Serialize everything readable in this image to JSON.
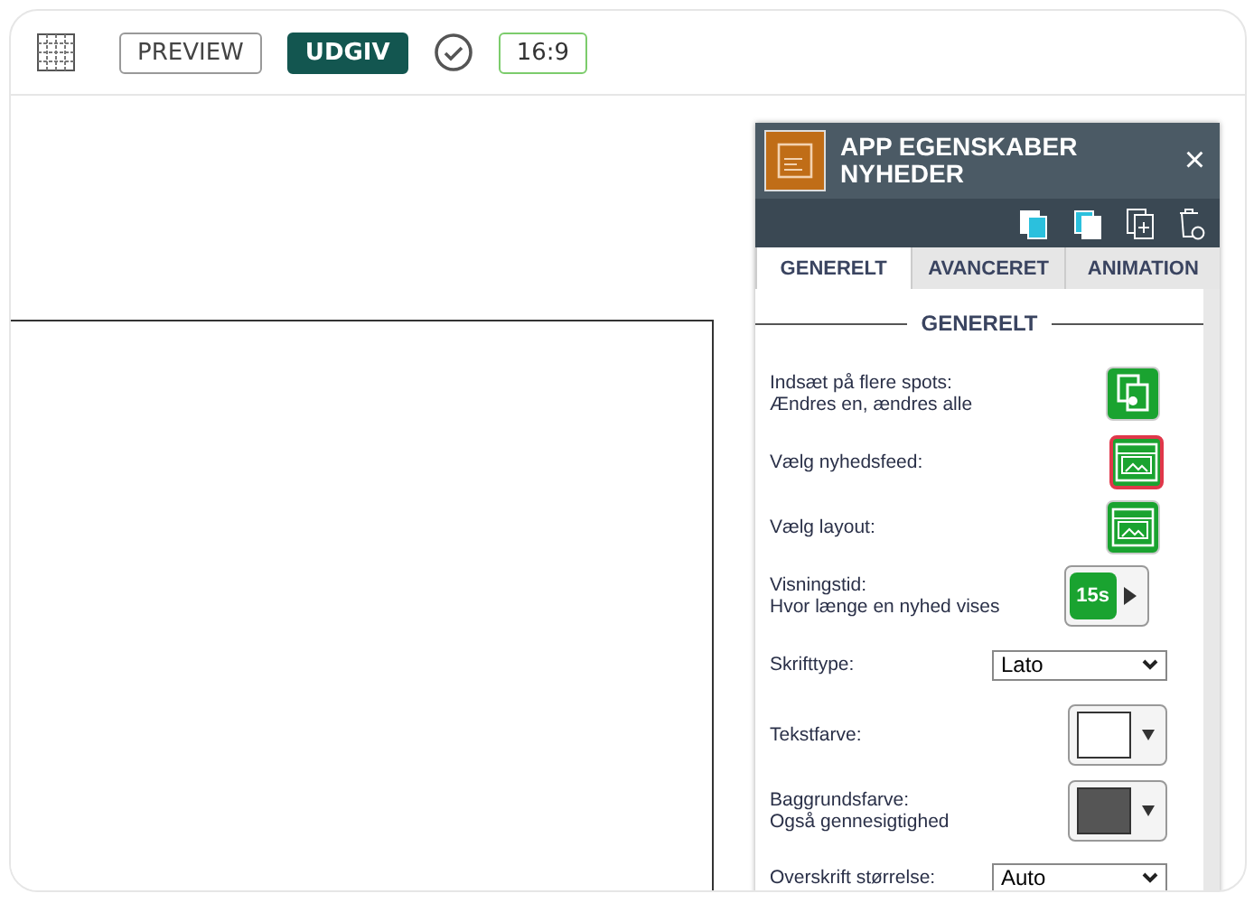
{
  "toolbar": {
    "preview": "PREVIEW",
    "publish": "UDGIV",
    "ratio": "16:9"
  },
  "panel": {
    "title": "APP EGENSKABER\nNYHEDER",
    "close": "×",
    "tabs": [
      {
        "label": "GENERELT",
        "selected": true
      },
      {
        "label": "AVANCERET",
        "selected": false
      },
      {
        "label": "ANIMATION",
        "selected": false
      }
    ],
    "section": "GENERELT",
    "rows": [
      {
        "kind": "button",
        "label": "Indsæt på flere spots:\nÆndres en, ændres alle",
        "selected": false
      },
      {
        "kind": "button",
        "label": "Vælg nyhedsfeed:",
        "selected": true
      },
      {
        "kind": "button",
        "label": "Vælg layout:",
        "selected": false
      },
      {
        "kind": "duration",
        "label": "Visningstid:\nHvor længe en nyhed vises",
        "value": "15s"
      },
      {
        "kind": "select",
        "label": "Skrifttype:",
        "value": "Lato"
      },
      {
        "kind": "color",
        "label": "Tekstfarve:",
        "color": "#ffffff"
      },
      {
        "kind": "color",
        "label": "Baggrundsfarve:\nOgså gennesigtighed",
        "color": "#555555"
      },
      {
        "kind": "select",
        "label": "Overskrift størrelse:",
        "value": "Auto"
      }
    ]
  }
}
